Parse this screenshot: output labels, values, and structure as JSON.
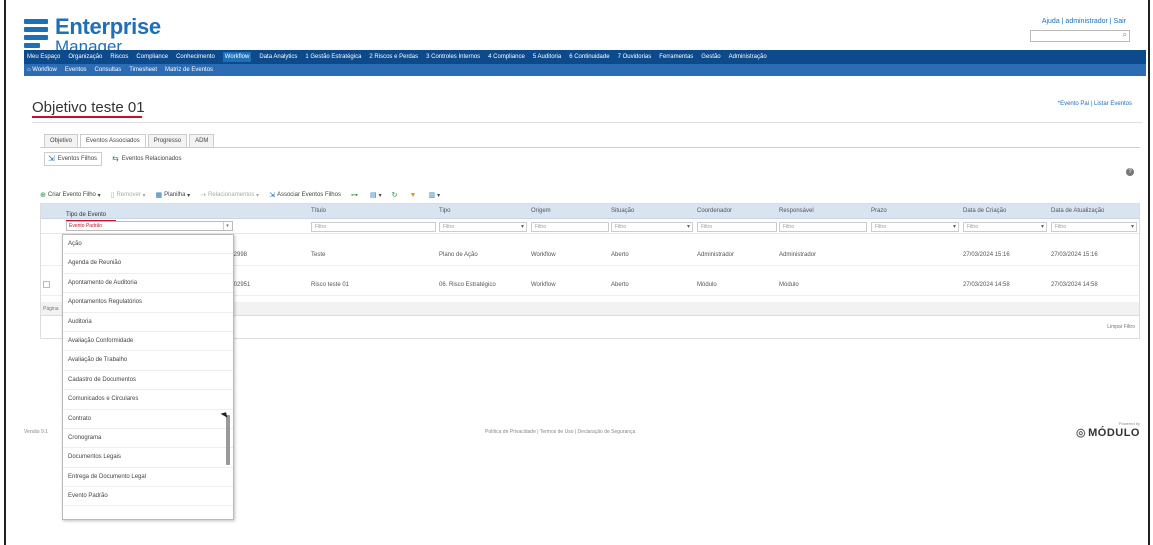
{
  "header": {
    "logo_line1": "Enterprise",
    "logo_line2": "Manager",
    "top_links": "Ajuda | administrador | Sair",
    "search_placeholder": ""
  },
  "main_menu": [
    "Meu Espaço",
    "Organização",
    "Riscos",
    "Compliance",
    "Conhecimento",
    "Workflow",
    "Data Analytics",
    "1 Gestão Estratégica",
    "2 Riscos e Perdas",
    "3 Controles Internos",
    "4 Compliance",
    "5 Auditoria",
    "6 Continuidade",
    "7 Ouvidorias",
    "Ferramentas",
    "Gestão",
    "Administração"
  ],
  "active_menu": "Workflow",
  "sub_menu": [
    "Workflow",
    "Eventos",
    "Consultas",
    "Timesheet",
    "Matriz de Eventos"
  ],
  "page_title": "Objetivo teste 01",
  "trail_link": "*Evento Pai | Listar Eventos",
  "tabs": [
    "Objetivo",
    "Eventos Associados",
    "Progresso",
    "ADM"
  ],
  "active_tab": "Eventos Associados",
  "subtabs": [
    "Eventos Filhos",
    "Eventos Relacionados"
  ],
  "toolbar": {
    "create": "Criar Evento Filho",
    "remove": "Remover",
    "planilha": "Planilha",
    "relacionamentos": "Relacionamentos",
    "associar": "Associar Eventos Filhos"
  },
  "grid": {
    "columns": [
      "Tipo de Evento",
      "Título",
      "Tipo",
      "Origem",
      "Situação",
      "Coordenador",
      "Responsável",
      "Prazo",
      "Data de Criação",
      "Data de Atualização"
    ],
    "filter_placeholder": "Filtro",
    "rows": [
      {
        "code": "002998",
        "titulo": "Teste",
        "tipo": "Plano de Ação",
        "origem": "Workflow",
        "situacao": "Aberto",
        "coordenador": "Administrador",
        "responsavel": "Administrador",
        "prazo": "",
        "criacao": "27/03/2024 15:16",
        "atualizacao": "27/03/2024 15:16"
      },
      {
        "code": "0002951",
        "titulo": "Risco teste 01",
        "tipo": "06. Risco Estratégico",
        "origem": "Workflow",
        "situacao": "Aberto",
        "coordenador": "Módulo",
        "responsavel": "Módulo",
        "prazo": "",
        "criacao": "27/03/2024 14:58",
        "atualizacao": "27/03/2024 14:58"
      }
    ],
    "pager_text": "Página",
    "clear_filters": "Limpar Filtro"
  },
  "dropdown": {
    "label": "Tipo de Evento",
    "selected": "Evento Padrão",
    "options": [
      "Ação",
      "Agenda de Reunião",
      "Apontamento de Auditoria",
      "Apontamentos Regulatórios",
      "Auditoria",
      "Avaliação Conformidade",
      "Avaliação de Trabalho",
      "Cadastro de Documentos",
      "Comunicados e Circulares",
      "Contrato",
      "Cronograma",
      "Documentos Legais",
      "Entrega de Documento Legal",
      "Evento Padrão"
    ]
  },
  "footer": {
    "version": "Versão 9.1",
    "links": "Política de Privacidade | Termos de Uso | Declaração de Segurança",
    "powered_by": "Powered by",
    "brand": "MÓDULO"
  },
  "colors": {
    "brand_blue": "#1d6fb8",
    "menu_blue": "#0d4a8c",
    "accent_red": "#c8102e"
  }
}
